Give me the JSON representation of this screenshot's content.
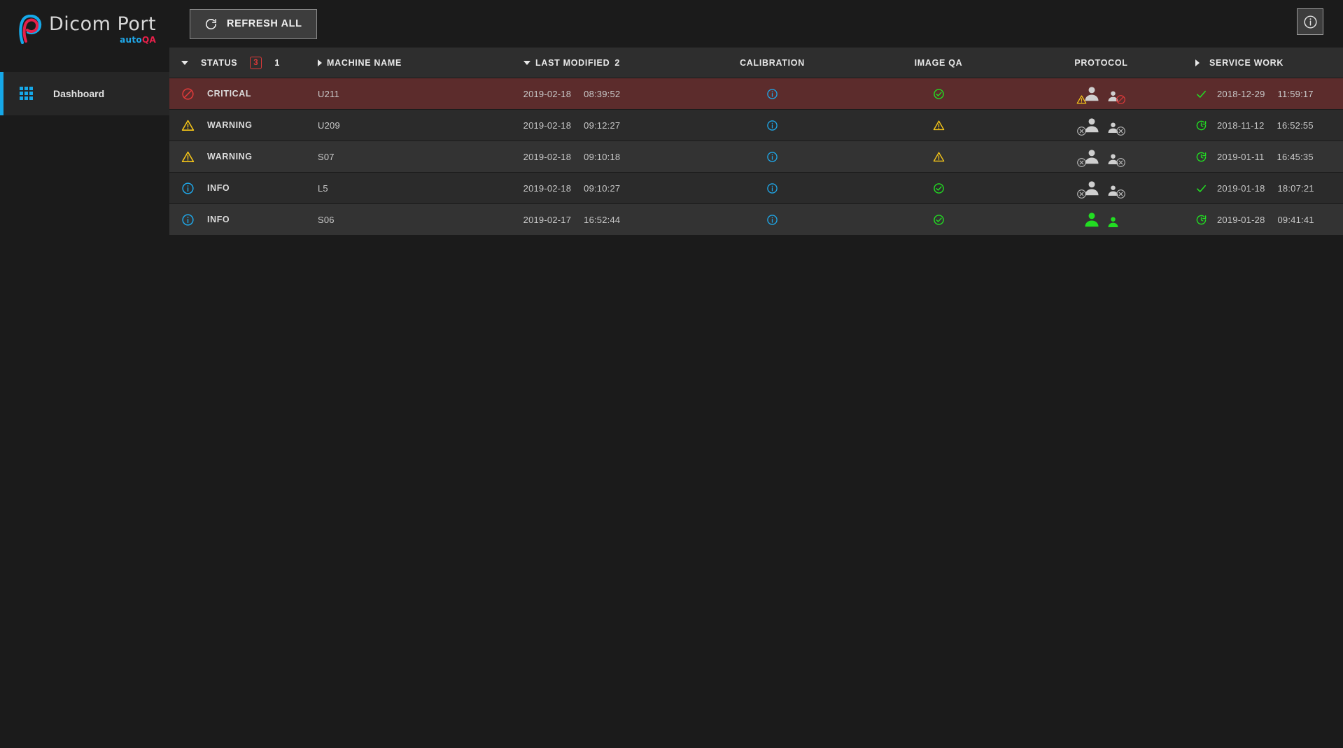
{
  "brand": {
    "name": "Dicom Port",
    "sub_part1": "auto",
    "sub_part2": "QA",
    "logo_icon": "dicom-port-p-logo",
    "accent_cyan": "#16a8e8",
    "accent_red": "#e8204a"
  },
  "sidebar": {
    "items": [
      {
        "label": "Dashboard",
        "icon": "grid-apps-icon",
        "active": true
      }
    ]
  },
  "toolbar": {
    "refresh_label": "REFRESH ALL",
    "refresh_icon": "refresh-icon",
    "info_icon": "info-circle-icon"
  },
  "table": {
    "columns": [
      {
        "key": "status",
        "label": "STATUS",
        "sort_icon": "caret-down",
        "badge": "3",
        "sort_order": "1"
      },
      {
        "key": "machine",
        "label": "MACHINE NAME",
        "sort_icon": "caret-right",
        "badge": "",
        "sort_order": ""
      },
      {
        "key": "modified",
        "label": "LAST MODIFIED",
        "sort_icon": "caret-down",
        "badge": "",
        "sort_order": "2"
      },
      {
        "key": "calib",
        "label": "CALIBRATION",
        "sort_icon": "",
        "badge": "",
        "sort_order": ""
      },
      {
        "key": "imageqa",
        "label": "IMAGE QA",
        "sort_icon": "",
        "badge": "",
        "sort_order": ""
      },
      {
        "key": "protocol",
        "label": "PROTOCOL",
        "sort_icon": "",
        "badge": "",
        "sort_order": ""
      },
      {
        "key": "service",
        "label": "SERVICE WORK",
        "sort_icon": "caret-right",
        "badge": "",
        "sort_order": ""
      }
    ],
    "rows": [
      {
        "severity": "critical",
        "status_label": "CRITICAL",
        "status_icon": "block-circle-icon",
        "machine_name": "U211",
        "modified_date": "2019-02-18",
        "modified_time": "08:39:52",
        "calibration_icon": "info-circle-icon",
        "imageqa_icon": "check-circle-icon",
        "protocol_icon_left_badge": "warning-triangle-icon",
        "protocol_icon_right_badge": "block-circle-icon",
        "protocol_people_color": "#cfcfcf",
        "service_icon": "check-icon",
        "service_date": "2018-12-29",
        "service_time": "11:59:17"
      },
      {
        "severity": "warning",
        "status_label": "WARNING",
        "status_icon": "warning-triangle-icon",
        "machine_name": "U209",
        "modified_date": "2019-02-18",
        "modified_time": "09:12:27",
        "calibration_icon": "info-circle-icon",
        "imageqa_icon": "warning-triangle-icon",
        "protocol_icon_left_badge": "x-circle-icon",
        "protocol_icon_right_badge": "x-circle-icon",
        "protocol_people_color": "#cfcfcf",
        "service_icon": "history-clock-icon",
        "service_date": "2018-11-12",
        "service_time": "16:52:55"
      },
      {
        "severity": "warning",
        "status_label": "WARNING",
        "status_icon": "warning-triangle-icon",
        "machine_name": "S07",
        "modified_date": "2019-02-18",
        "modified_time": "09:10:18",
        "calibration_icon": "info-circle-icon",
        "imageqa_icon": "warning-triangle-icon",
        "protocol_icon_left_badge": "x-circle-icon",
        "protocol_icon_right_badge": "x-circle-icon",
        "protocol_people_color": "#cfcfcf",
        "service_icon": "history-clock-icon",
        "service_date": "2019-01-11",
        "service_time": "16:45:35"
      },
      {
        "severity": "info",
        "status_label": "INFO",
        "status_icon": "info-circle-icon",
        "machine_name": "L5",
        "modified_date": "2019-02-18",
        "modified_time": "09:10:27",
        "calibration_icon": "info-circle-icon",
        "imageqa_icon": "check-circle-icon",
        "protocol_icon_left_badge": "x-circle-icon",
        "protocol_icon_right_badge": "x-circle-icon",
        "protocol_people_color": "#cfcfcf",
        "service_icon": "check-icon",
        "service_date": "2019-01-18",
        "service_time": "18:07:21"
      },
      {
        "severity": "info",
        "status_label": "INFO",
        "status_icon": "info-circle-icon",
        "machine_name": "S06",
        "modified_date": "2019-02-17",
        "modified_time": "16:52:44",
        "calibration_icon": "info-circle-icon",
        "imageqa_icon": "check-circle-icon",
        "protocol_icon_left_badge": "",
        "protocol_icon_right_badge": "",
        "protocol_people_color": "#22dd22",
        "service_icon": "history-clock-icon",
        "service_date": "2019-01-28",
        "service_time": "09:41:41"
      }
    ]
  },
  "colors": {
    "critical_red": "#e03a3a",
    "warning_yellow": "#f5c518",
    "info_blue": "#1fa7e8",
    "ok_green": "#22dd22",
    "row_critical_bg": "#5c2c2c"
  }
}
